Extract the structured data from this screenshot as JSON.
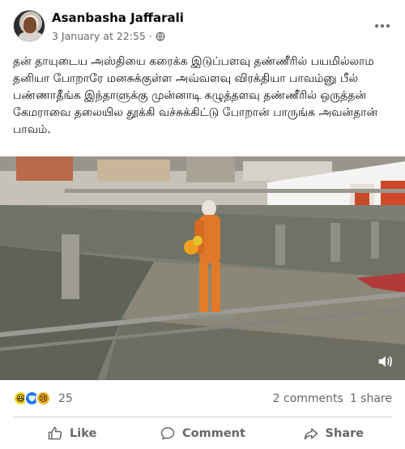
{
  "post": {
    "author": "Asanbasha Jaffarali",
    "timestamp": "3 January at 22:55",
    "separator": "·",
    "privacy_icon": "globe-icon",
    "text": "தன் தாயுடைய அஸ்தியை கரைக்க இடுப்பளவு தண்ணீரில் பயமில்லாம தனியா போறாரே மனசுக்குள்ள அவ்வளவு விரக்தியா பாவம்னு பீல் பண்ணாதீங்க இந்தாளுக்கு முன்னாடி கழுத்தளவு தண்ணீரில் ஒருத்தன் கேமராவை தலையில தூக்கி வச்சுக்கிட்டு போறான் பாருங்க அவன்தான் பாவம்."
  },
  "media": {
    "type": "video",
    "overlay_icon": "speaker-icon"
  },
  "engagement": {
    "reactions": [
      "haha",
      "love",
      "sad"
    ],
    "reaction_count": "25",
    "comments": "2 comments",
    "shares": "1 share"
  },
  "actions": {
    "like": "Like",
    "comment": "Comment",
    "share": "Share"
  },
  "colors": {
    "text": "#050505",
    "secondary": "#65676b",
    "divider": "#ced0d4",
    "love": "#1877f2",
    "haha": "#f7d11d"
  }
}
